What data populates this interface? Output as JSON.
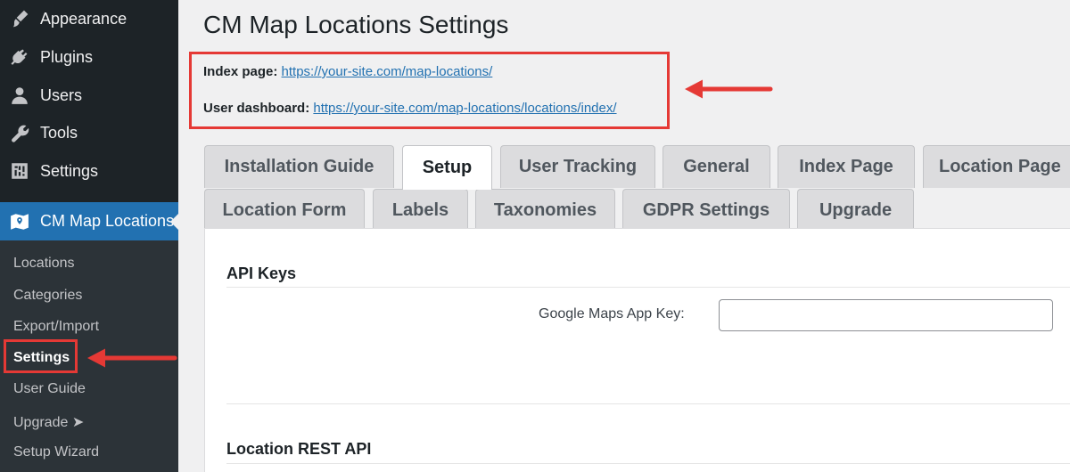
{
  "sidebar": {
    "items": [
      {
        "label": "Appearance",
        "icon": "paintbrush-icon"
      },
      {
        "label": "Plugins",
        "icon": "plugin-icon"
      },
      {
        "label": "Users",
        "icon": "users-icon"
      },
      {
        "label": "Tools",
        "icon": "wrench-icon"
      },
      {
        "label": "Settings",
        "icon": "settings-sliders-icon"
      }
    ],
    "active_item": {
      "label": "CM Map Locations",
      "icon": "map-icon"
    },
    "submenu": [
      {
        "label": "Locations"
      },
      {
        "label": "Categories"
      },
      {
        "label": "Export/Import"
      },
      {
        "label": "Settings"
      },
      {
        "label": "User Guide"
      },
      {
        "label": "Upgrade ➤"
      },
      {
        "label": "Setup Wizard"
      }
    ]
  },
  "page": {
    "title": "CM Map Locations Settings",
    "index_page_label": "Index page:",
    "index_page_url": "https://your-site.com/map-locations/",
    "user_dashboard_label": "User dashboard:",
    "user_dashboard_url": "https://your-site.com/map-locations/locations/index/"
  },
  "tabs": {
    "row1": [
      "Installation Guide",
      "Setup",
      "User Tracking",
      "General",
      "Index Page",
      "Location Page"
    ],
    "row2": [
      "Location Form",
      "Labels",
      "Taxonomies",
      "GDPR Settings",
      "Upgrade"
    ],
    "active": "Setup"
  },
  "panel": {
    "section1_title": "API Keys",
    "google_maps_label": "Google Maps App Key:",
    "google_maps_value": "",
    "section2_title": "Location REST API"
  },
  "colors": {
    "sidebar_bg": "#1d2327",
    "submenu_bg": "#2c3338",
    "accent": "#2271b1",
    "highlight_red": "#e53935"
  }
}
